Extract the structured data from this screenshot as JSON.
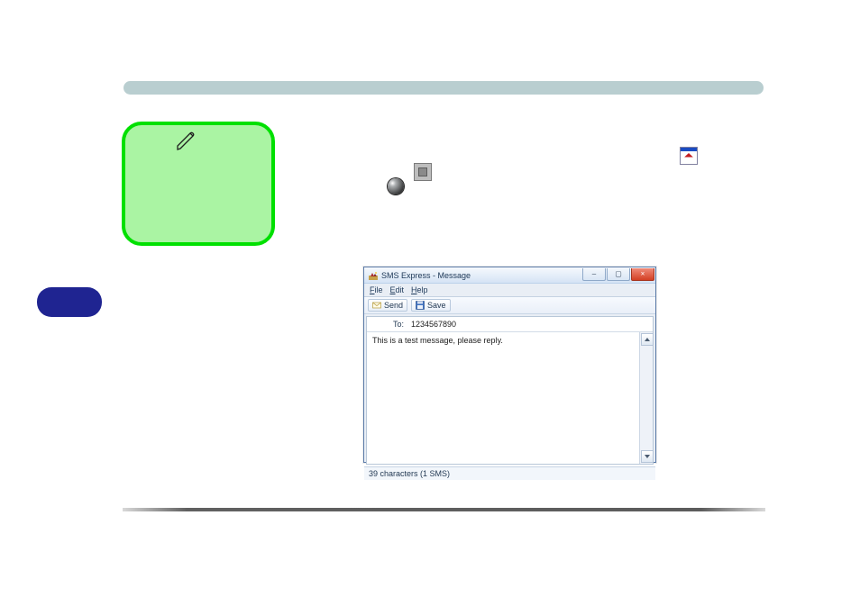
{
  "title_bar": {
    "title": "SMS Express - Message"
  },
  "window_controls": {
    "minimize_label": "–",
    "maximize_label": "▢",
    "close_label": "×"
  },
  "menu": {
    "file": "File",
    "edit": "Edit",
    "help": "Help"
  },
  "toolbar": {
    "send_label": "Send",
    "save_label": "Save"
  },
  "to_field": {
    "label": "To:",
    "value": "1234567890"
  },
  "message_body": "This is a test message, please reply.",
  "status_bar": "39 characters (1 SMS)",
  "icons": {
    "pencil": "pencil-icon",
    "stop": "stop-icon",
    "sphere": "sphere-icon",
    "app_shortcut": "app-shortcut-icon",
    "send": "envelope-icon",
    "save": "floppy-icon",
    "app": "app-icon"
  }
}
